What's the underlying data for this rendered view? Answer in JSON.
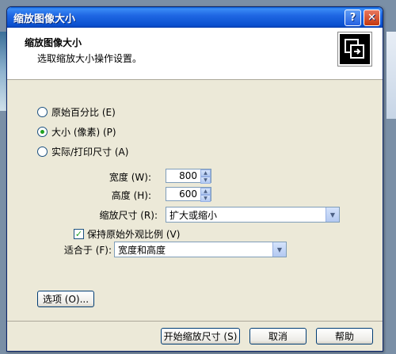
{
  "window": {
    "title": "缩放图像大小",
    "help_btn": "?",
    "close_btn": "✕"
  },
  "header": {
    "title": "缩放图像大小",
    "subtitle": "选取缩放大小操作设置。",
    "icon": "resize-icon"
  },
  "options": {
    "original_percent": "原始百分比 (E)",
    "size_pixels": "大小 (像素) (P)",
    "actual_print": "实际/打印尺寸 (A)",
    "selected": "size_pixels"
  },
  "fields": {
    "width_label": "宽度 (W):",
    "width_value": "800",
    "height_label": "高度 (H):",
    "height_value": "600",
    "scale_label": "缩放尺寸 (R):",
    "scale_value": "扩大或缩小",
    "keep_ratio_label": "保持原始外观比例 (V)",
    "keep_ratio_checked": true,
    "fit_label": "适合于 (F):",
    "fit_value": "宽度和高度"
  },
  "buttons": {
    "options": "选项 (O)...",
    "start": "开始缩放尺寸 (S)",
    "cancel": "取消",
    "help": "帮助"
  },
  "colors": {
    "titlebar": "#0a50cf",
    "dialog_bg": "#ECE9D8",
    "check_green": "#21a121"
  }
}
